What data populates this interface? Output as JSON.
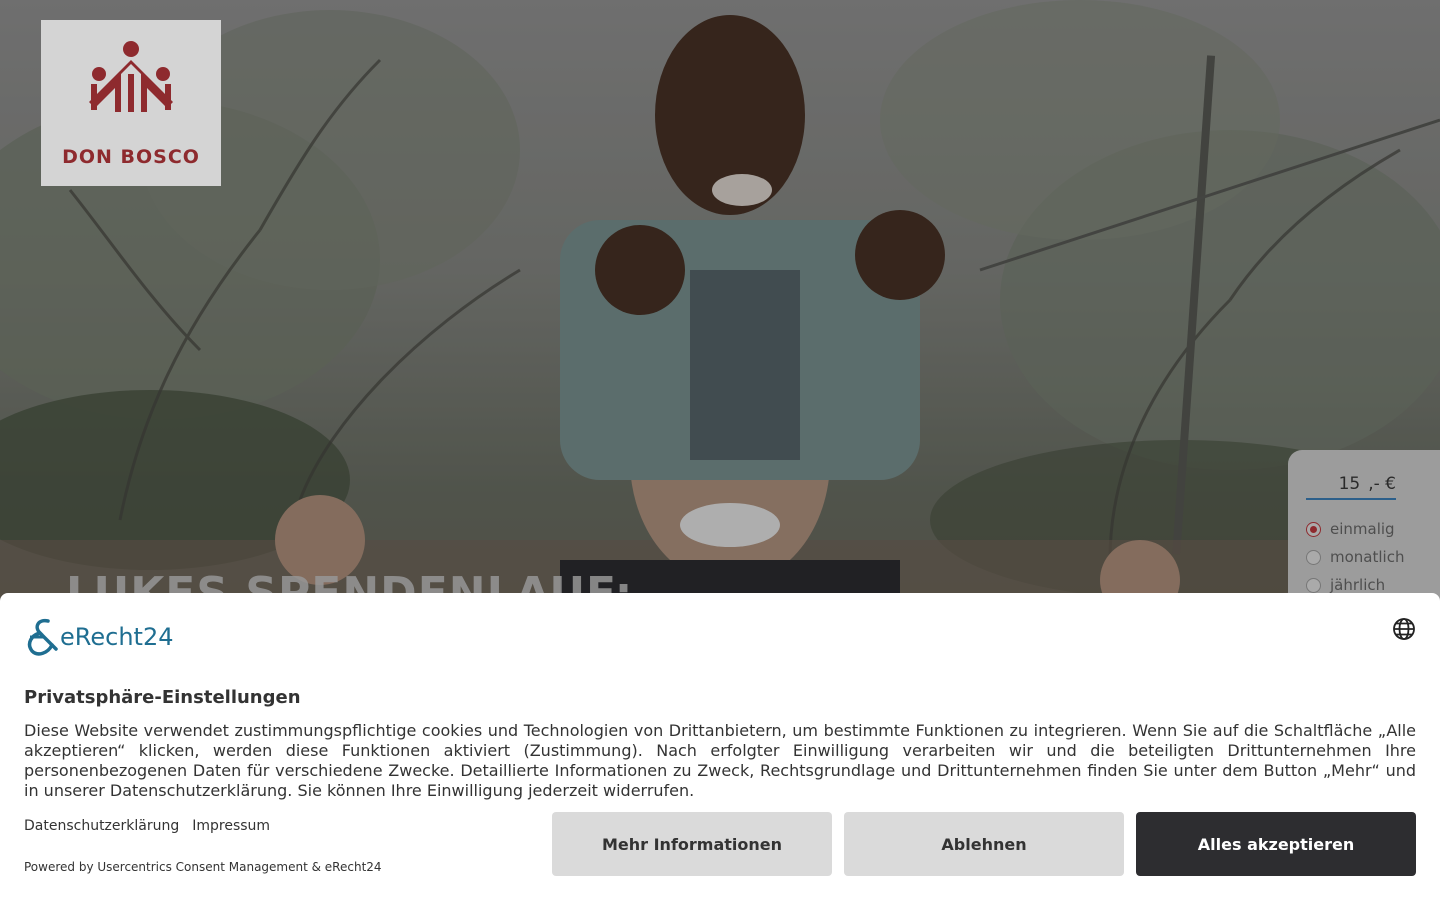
{
  "logo": {
    "text": "DON BOSCO",
    "color": "#8e2a2e"
  },
  "hero": {
    "title": "LUKES SPENDENLAUF:"
  },
  "donation": {
    "amount": "15",
    "currency": ",- €",
    "options": [
      {
        "label": "einmalig",
        "checked": true
      },
      {
        "label": "monatlich",
        "checked": false
      },
      {
        "label": "jährlich",
        "checked": false
      }
    ]
  },
  "consent": {
    "brand": "eRecht24",
    "title": "Privatsphäre-Einstellungen",
    "text": "Diese Website verwendet zustimmungspflichtige cookies und Technologien von Drittanbietern, um bestimmte Funktionen zu integrieren. Wenn Sie auf die Schaltfläche „Alle akzeptieren“ klicken, werden diese Funktionen aktiviert (Zustimmung). Nach erfolgter Einwilligung verarbeiten wir und die beteiligten Drittunternehmen Ihre personenbezogenen Daten für verschiedene Zwecke. Detaillierte Informationen zu Zweck, Rechtsgrundlage und Drittunternehmen finden Sie unter dem Button „Mehr“ und in unserer Datenschutzerklärung. Sie können Ihre Einwilligung jederzeit widerrufen.",
    "links": {
      "privacy": "Datenschutzerklärung",
      "imprint": "Impressum"
    },
    "powered": "Powered by Usercentrics Consent Management & eRecht24",
    "buttons": {
      "more": "Mehr Informationen",
      "deny": "Ablehnen",
      "accept": "Alles akzeptieren"
    },
    "accent_color": "#1f6e91",
    "accept_color": "#2d2d30"
  }
}
